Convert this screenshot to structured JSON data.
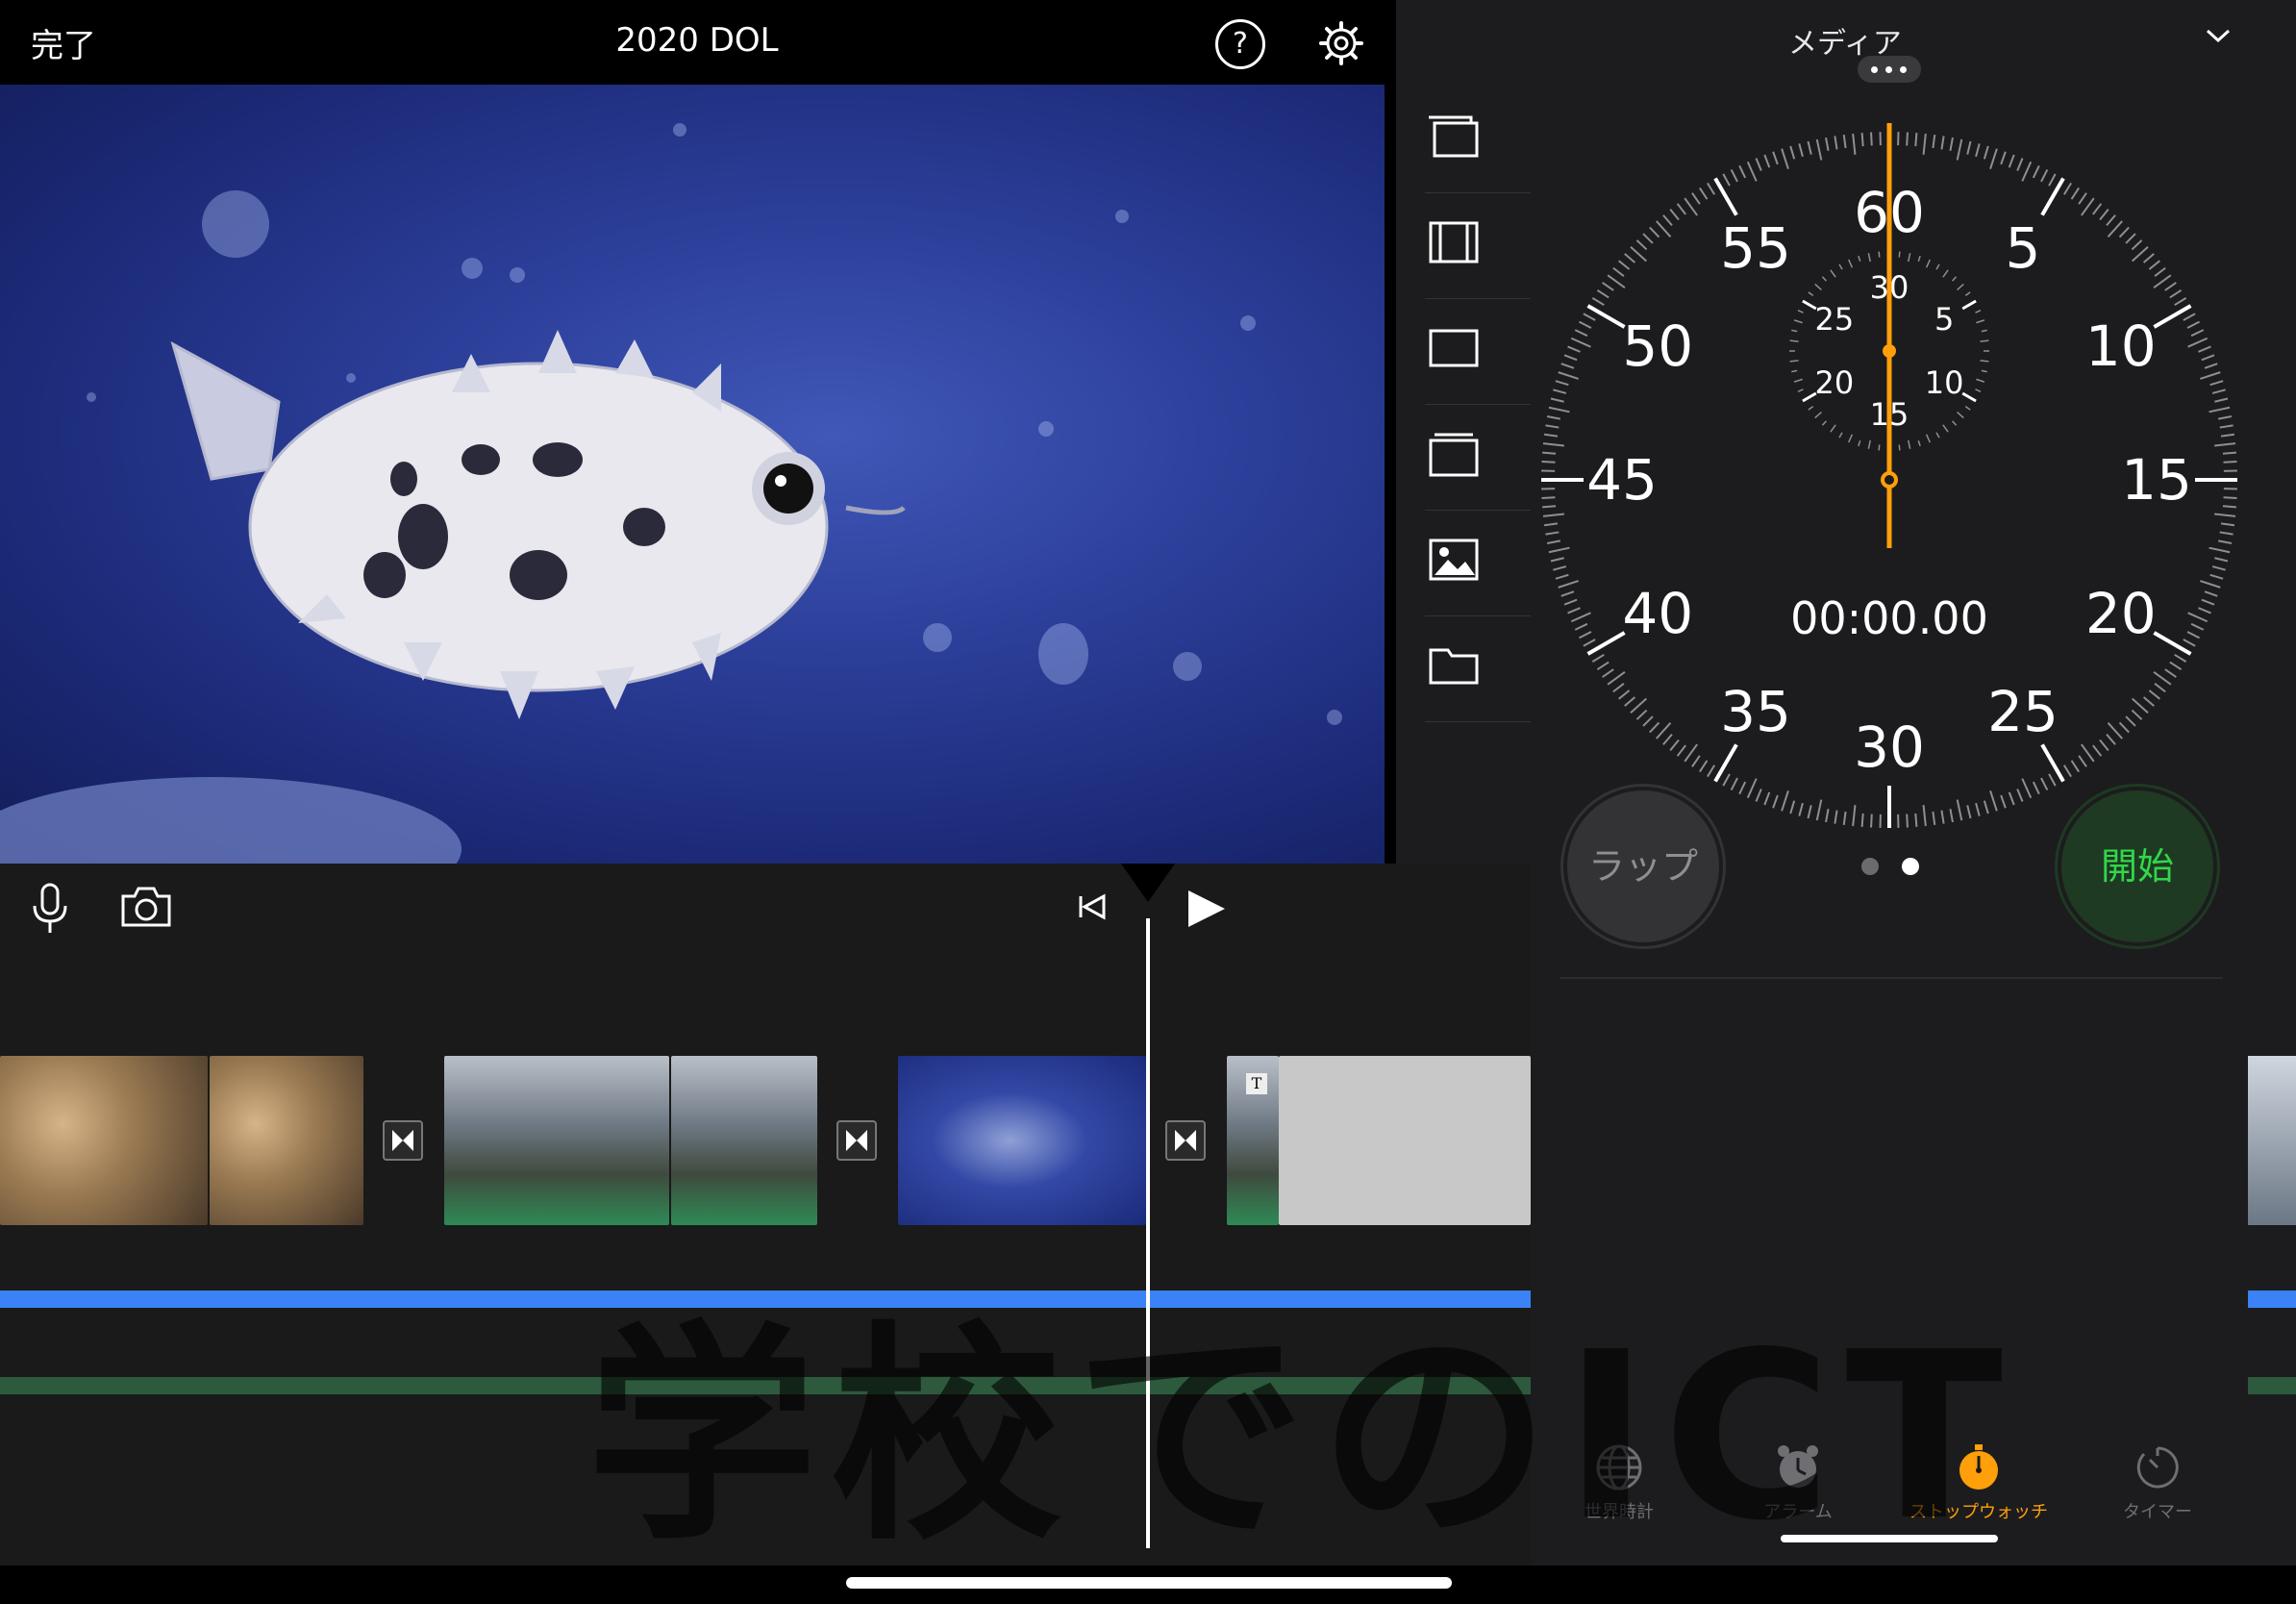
{
  "editor": {
    "done_label": "完了",
    "project_title": "2020 DOL",
    "help_label": "?"
  },
  "stopwatch": {
    "header_title": "メディア",
    "dial_labels": [
      "60",
      "5",
      "10",
      "15",
      "20",
      "25",
      "30",
      "35",
      "40",
      "45",
      "50",
      "55"
    ],
    "subdial_labels": [
      "30",
      "5",
      "10",
      "15",
      "20",
      "25"
    ],
    "time_display": "00:00.00",
    "lap_label": "ラップ",
    "start_label": "開始",
    "page_count": 2,
    "current_page": 2
  },
  "tabs": [
    {
      "label": "世界時計",
      "icon": "globe-icon",
      "active": false
    },
    {
      "label": "アラーム",
      "icon": "alarm-clock-icon",
      "active": false
    },
    {
      "label": "ストップウォッチ",
      "icon": "stopwatch-icon",
      "active": true
    },
    {
      "label": "タイマー",
      "icon": "timer-icon",
      "active": false
    }
  ],
  "watermark": "学校でのICT",
  "colors": {
    "accent_orange": "#ff9f0a",
    "start_green": "#32d74b",
    "audio_blue": "#3b82f6",
    "audio_green": "#2d5a3d"
  }
}
